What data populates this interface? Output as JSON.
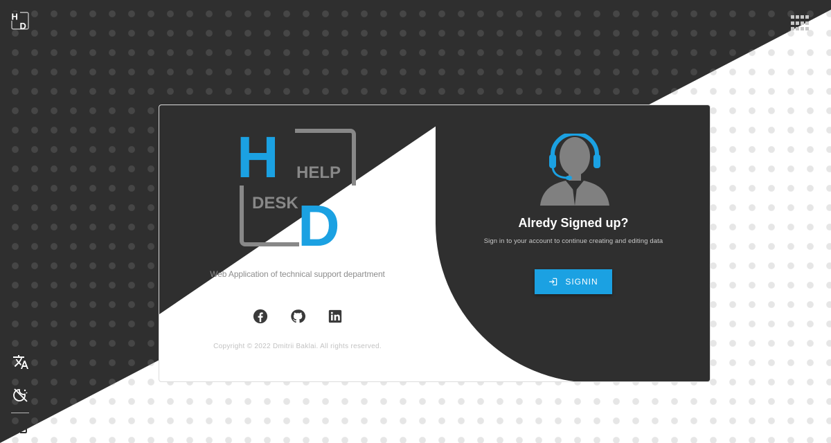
{
  "colors": {
    "dark": "#2f2f2f",
    "accent": "#1ba1e2",
    "logo_gray": "#888888",
    "white": "#ffffff"
  },
  "corner": {
    "logo_icon": "hd-logo-icon",
    "apps_icon": "apps-grid-icon"
  },
  "sidebar": {
    "items": [
      {
        "icon": "translate-icon",
        "label": "Language"
      },
      {
        "icon": "theme-toggle-icon",
        "label": "Theme"
      },
      {
        "icon": "login-icon",
        "label": "Sign in"
      }
    ]
  },
  "card": {
    "logo": {
      "big_h": "H",
      "big_d": "D",
      "help": "HELP",
      "desk": "DESK"
    },
    "tagline": "Web Application of technical support department",
    "socials": [
      {
        "icon": "facebook-icon"
      },
      {
        "icon": "github-icon"
      },
      {
        "icon": "linkedin-icon"
      }
    ],
    "copyright": "Copyright © 2022 Dmitrii Baklai. All rights reserved.",
    "right": {
      "avatar_icon": "support-agent-icon",
      "title": "Alredy Signed up?",
      "subtitle": "Sign in to your account to continue creating and editing data",
      "button_label": "SIGNIN",
      "button_icon": "login-icon"
    }
  }
}
